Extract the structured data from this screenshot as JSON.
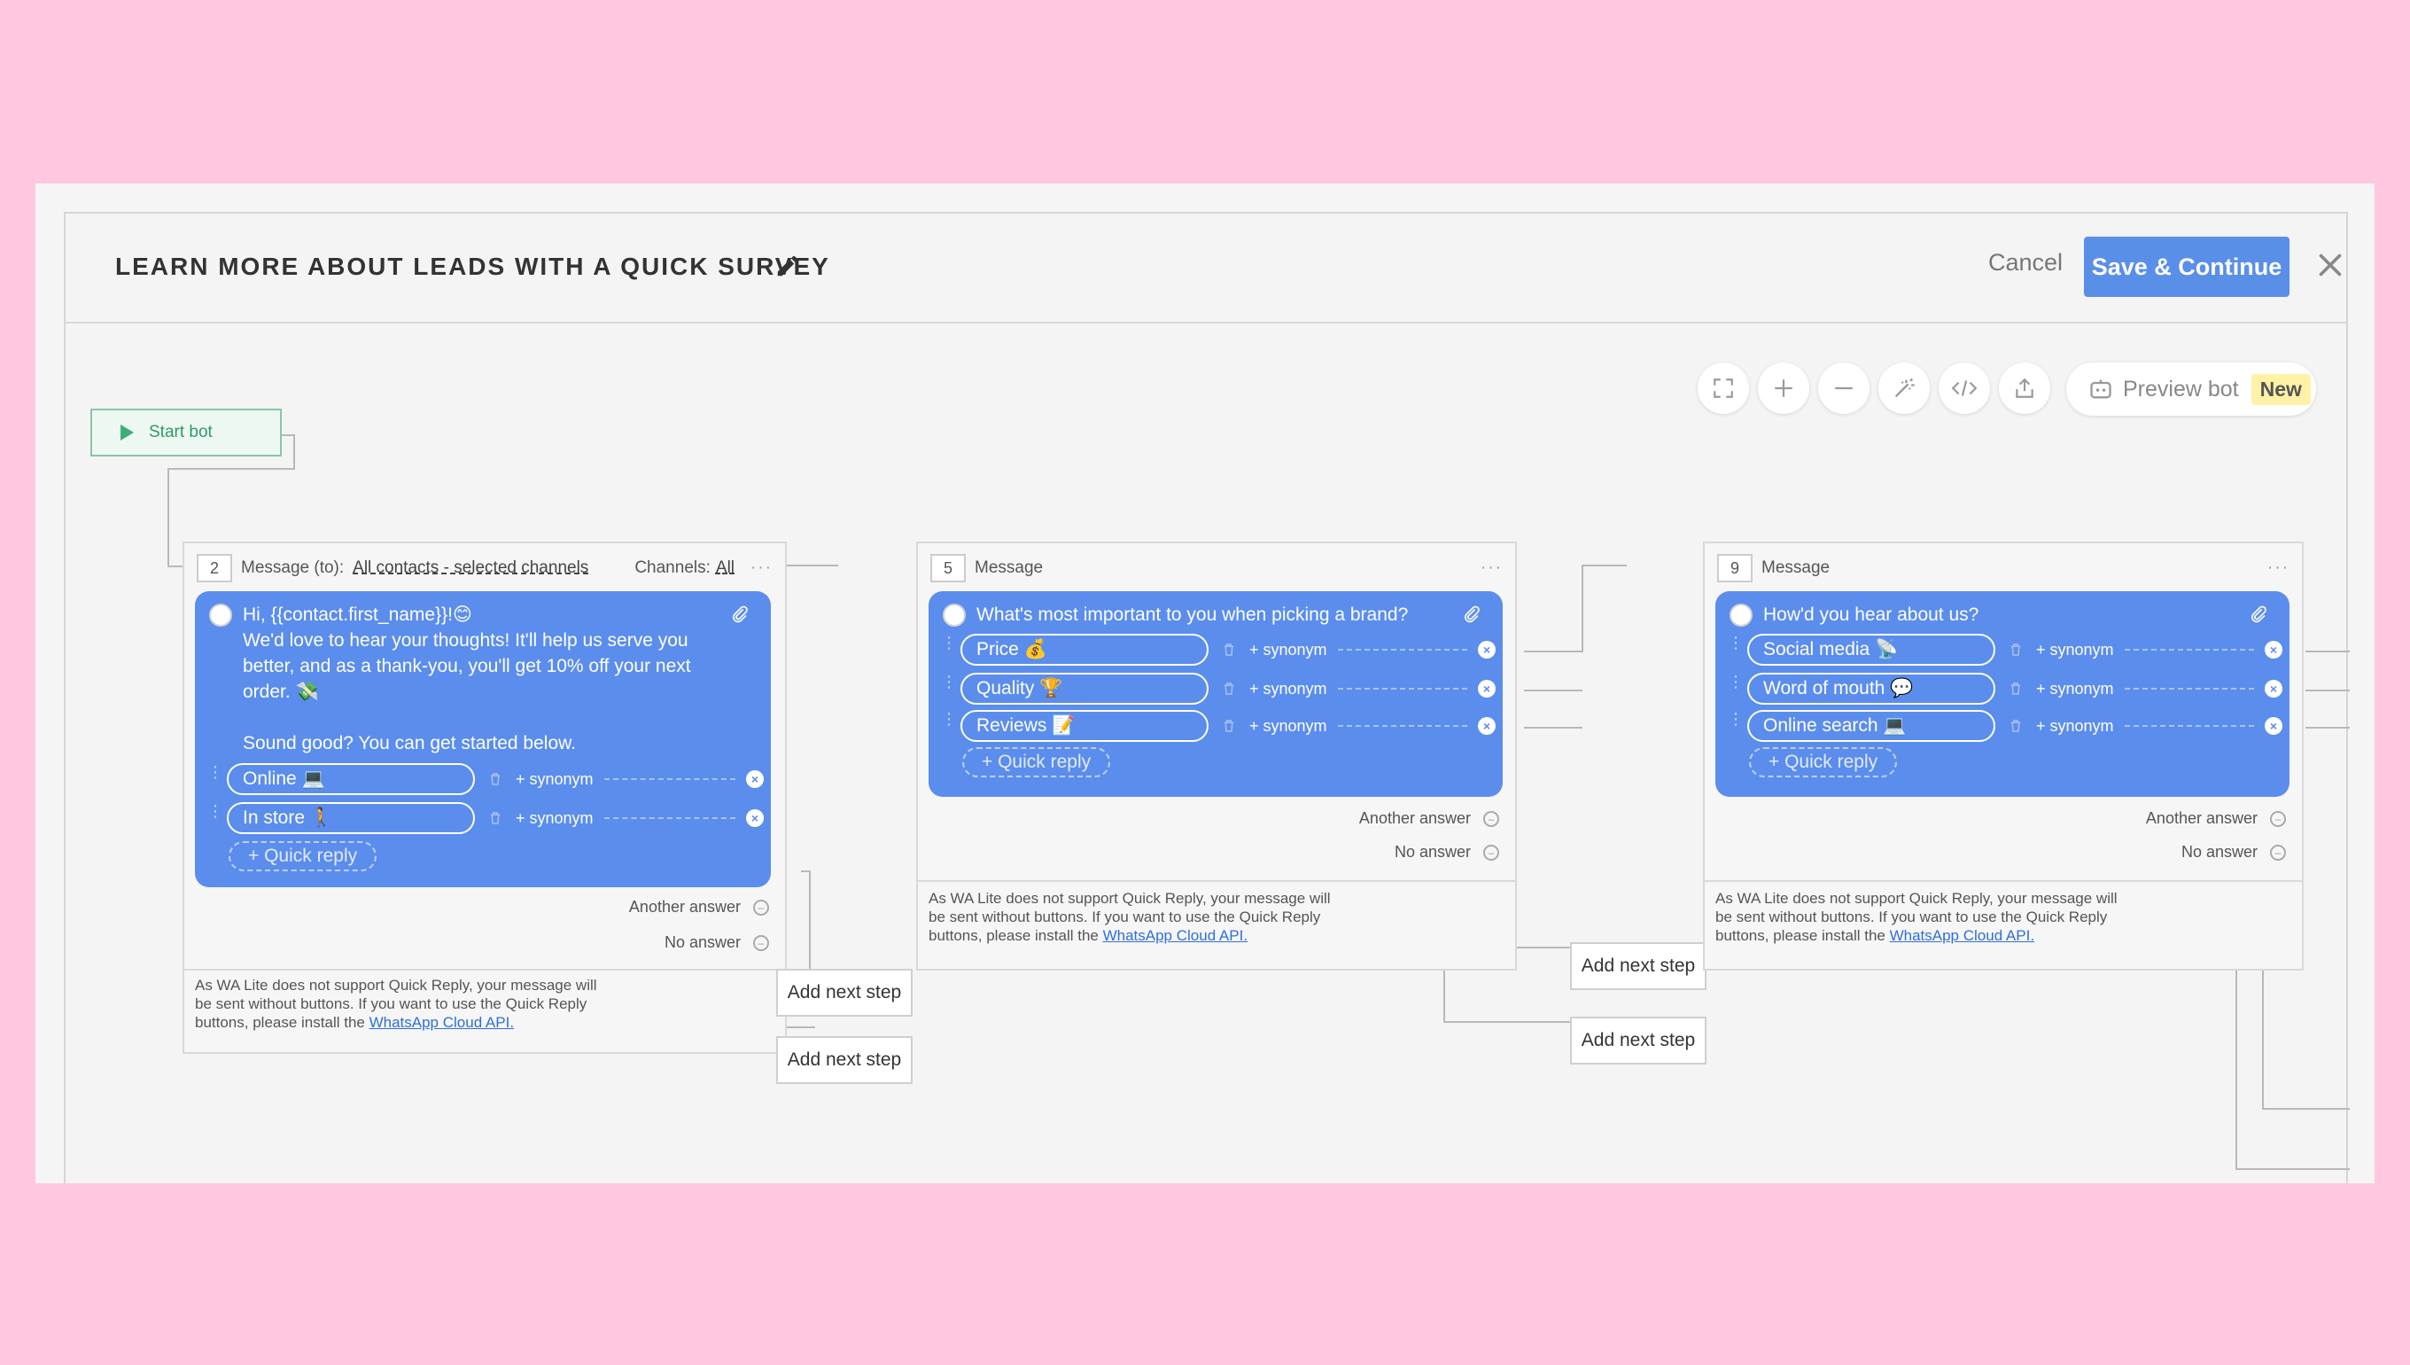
{
  "header": {
    "title": "LEARN MORE ABOUT LEADS WITH A QUICK SURVEY",
    "cancel_label": "Cancel",
    "save_label": "Save & Continue"
  },
  "toolbar": {
    "icons": [
      "fullscreen-icon",
      "zoom-in-icon",
      "zoom-out-icon",
      "magic-wand-icon",
      "code-icon",
      "export-icon"
    ],
    "preview_label": "Preview bot",
    "preview_badge": "New"
  },
  "start_node": {
    "label": "Start bot"
  },
  "nodes": [
    {
      "number": "2",
      "type": "Message (to):",
      "audience": "All contacts - selected channels",
      "channels_label": "Channels:",
      "channels_value": "All",
      "message_lines": [
        "Hi, {{contact.first_name}}!😊",
        "We'd love to hear your thoughts! It'll help us serve you",
        "better, and as a thank-you, you'll get 10% off your next",
        "order. 💸",
        "",
        "Sound good? You can get started below."
      ],
      "replies": [
        "Online 💻",
        "In store 🚶"
      ],
      "synonym_label": "+ synonym",
      "quick_reply_label": "+ Quick reply",
      "another_answer": "Another answer",
      "no_answer": "No answer",
      "note_lines": [
        "As WA Lite does not support Quick Reply, your message will",
        "be sent without buttons. If you want to use the Quick Reply",
        "buttons, please install the "
      ],
      "note_link": "WhatsApp Cloud API."
    },
    {
      "number": "5",
      "type": "Message",
      "question": "What's most important to you when picking a brand?",
      "replies": [
        "Price 💰",
        "Quality 🏆",
        "Reviews 📝"
      ],
      "synonym_label": "+ synonym",
      "quick_reply_label": "+ Quick reply",
      "another_answer": "Another answer",
      "no_answer": "No answer",
      "note_lines": [
        "As WA Lite does not support Quick Reply, your message will",
        "be sent without buttons. If you want to use the Quick Reply",
        "buttons, please install the "
      ],
      "note_link": "WhatsApp Cloud API."
    },
    {
      "number": "9",
      "type": "Message",
      "question": "How'd you hear about us?",
      "replies": [
        "Social media 📡",
        "Word of mouth 💬",
        "Online search 💻"
      ],
      "synonym_label": "+ synonym",
      "quick_reply_label": "+ Quick reply",
      "another_answer": "Another answer",
      "no_answer": "No answer",
      "note_lines": [
        "As WA Lite does not support Quick Reply, your message will",
        "be sent without buttons. If you want to use the Quick Reply",
        "buttons, please install the "
      ],
      "note_link": "WhatsApp Cloud API."
    }
  ],
  "add_next_step_label": "Add next step",
  "colors": {
    "accent": "#5a8fe8",
    "card": "#5b8ded",
    "start": "#2e9a66",
    "background": "#ffc8e0"
  }
}
